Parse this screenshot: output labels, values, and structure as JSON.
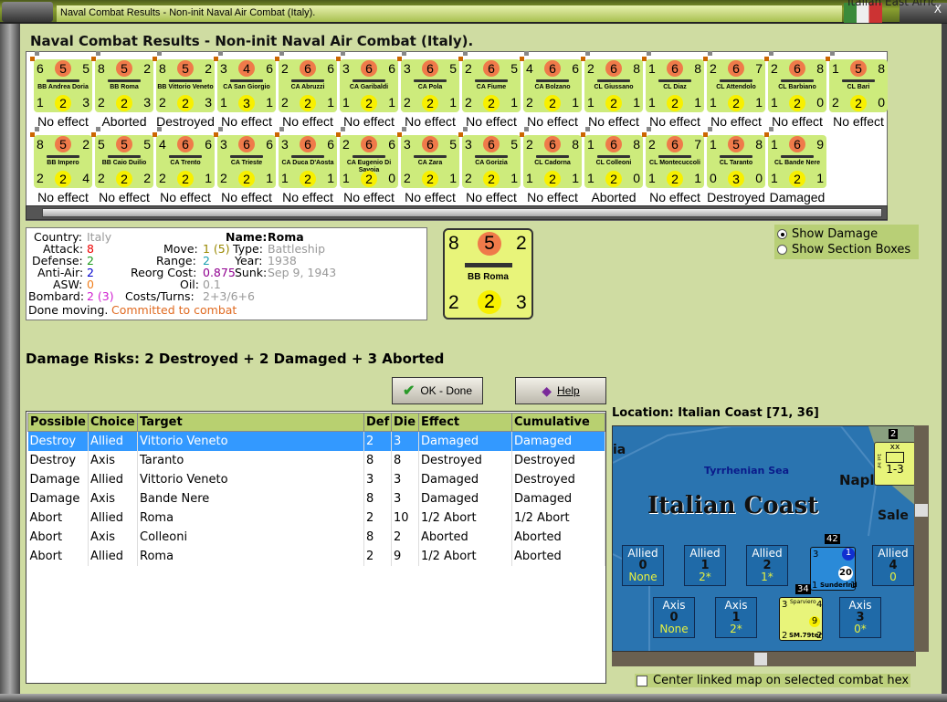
{
  "window": {
    "title": "Naval Combat Results - Non-init Naval Air Combat (Italy).",
    "corner_text": "Italian East Afric",
    "close": "X"
  },
  "heading": "Naval Combat Results - Non-init Naval Air Combat (Italy).",
  "units": [
    {
      "name": "BB Andrea Doria",
      "tl": "6",
      "tc": "5",
      "tr": "5",
      "bl": "1",
      "bc": "2",
      "br": "3",
      "result": "No effect"
    },
    {
      "name": "BB Roma",
      "tl": "8",
      "tc": "5",
      "tr": "2",
      "bl": "2",
      "bc": "2",
      "br": "3",
      "result": "Aborted"
    },
    {
      "name": "BB Vittorio Veneto",
      "tl": "8",
      "tc": "5",
      "tr": "2",
      "bl": "2",
      "bc": "2",
      "br": "3",
      "result": "Destroyed"
    },
    {
      "name": "CA San Giorgio",
      "tl": "3",
      "tc": "4",
      "tr": "6",
      "bl": "1",
      "bc": "3",
      "br": "1",
      "result": "No effect"
    },
    {
      "name": "CA Abruzzi",
      "tl": "2",
      "tc": "6",
      "tr": "6",
      "bl": "2",
      "bc": "2",
      "br": "1",
      "result": "No effect"
    },
    {
      "name": "CA Garibaldi",
      "tl": "3",
      "tc": "6",
      "tr": "6",
      "bl": "1",
      "bc": "2",
      "br": "1",
      "result": "No effect"
    },
    {
      "name": "CA Pola",
      "tl": "3",
      "tc": "6",
      "tr": "5",
      "bl": "2",
      "bc": "2",
      "br": "1",
      "result": "No effect"
    },
    {
      "name": "CA Fiume",
      "tl": "2",
      "tc": "6",
      "tr": "5",
      "bl": "2",
      "bc": "2",
      "br": "1",
      "result": "No effect"
    },
    {
      "name": "CA Bolzano",
      "tl": "4",
      "tc": "6",
      "tr": "6",
      "bl": "2",
      "bc": "2",
      "br": "1",
      "result": "No effect"
    },
    {
      "name": "CL Giussano",
      "tl": "2",
      "tc": "6",
      "tr": "8",
      "bl": "1",
      "bc": "2",
      "br": "1",
      "result": "No effect"
    },
    {
      "name": "CL Diaz",
      "tl": "1",
      "tc": "6",
      "tr": "8",
      "bl": "1",
      "bc": "2",
      "br": "1",
      "result": "No effect"
    },
    {
      "name": "CL Attendolo",
      "tl": "2",
      "tc": "6",
      "tr": "7",
      "bl": "1",
      "bc": "2",
      "br": "1",
      "result": "No effect"
    },
    {
      "name": "CL Barbiano",
      "tl": "2",
      "tc": "6",
      "tr": "8",
      "bl": "1",
      "bc": "2",
      "br": "0",
      "result": "No effect"
    },
    {
      "name": "CL Bari",
      "tl": "1",
      "tc": "5",
      "tr": "8",
      "bl": "2",
      "bc": "2",
      "br": "0",
      "result": "No effect"
    },
    {
      "name": "BB Impero",
      "tl": "8",
      "tc": "5",
      "tr": "2",
      "bl": "2",
      "bc": "2",
      "br": "4",
      "result": "No effect"
    },
    {
      "name": "BB Caio Duilio",
      "tl": "5",
      "tc": "5",
      "tr": "5",
      "bl": "2",
      "bc": "2",
      "br": "2",
      "result": "No effect"
    },
    {
      "name": "CA Trento",
      "tl": "4",
      "tc": "6",
      "tr": "6",
      "bl": "2",
      "bc": "2",
      "br": "1",
      "result": "No effect"
    },
    {
      "name": "CA Trieste",
      "tl": "3",
      "tc": "6",
      "tr": "6",
      "bl": "2",
      "bc": "2",
      "br": "1",
      "result": "No effect"
    },
    {
      "name": "CA Duca D'Aosta",
      "tl": "3",
      "tc": "6",
      "tr": "6",
      "bl": "1",
      "bc": "2",
      "br": "1",
      "result": "No effect"
    },
    {
      "name": "CA Eugenio Di Savoia",
      "tl": "2",
      "tc": "6",
      "tr": "6",
      "bl": "1",
      "bc": "2",
      "br": "0",
      "result": "No effect"
    },
    {
      "name": "CA Zara",
      "tl": "3",
      "tc": "6",
      "tr": "5",
      "bl": "2",
      "bc": "2",
      "br": "1",
      "result": "No effect"
    },
    {
      "name": "CA Gorizia",
      "tl": "3",
      "tc": "6",
      "tr": "5",
      "bl": "2",
      "bc": "2",
      "br": "1",
      "result": "No effect"
    },
    {
      "name": "CL Cadorna",
      "tl": "2",
      "tc": "6",
      "tr": "8",
      "bl": "1",
      "bc": "2",
      "br": "1",
      "result": "No effect"
    },
    {
      "name": "CL Colleoni",
      "tl": "1",
      "tc": "6",
      "tr": "8",
      "bl": "1",
      "bc": "2",
      "br": "0",
      "result": "Aborted"
    },
    {
      "name": "CL Montecuccoli",
      "tl": "2",
      "tc": "6",
      "tr": "7",
      "bl": "1",
      "bc": "2",
      "br": "1",
      "result": "No effect"
    },
    {
      "name": "CL Taranto",
      "tl": "1",
      "tc": "5",
      "tr": "8",
      "bl": "0",
      "bc": "3",
      "br": "0",
      "result": "Destroyed"
    },
    {
      "name": "CL Bande Nere",
      "tl": "1",
      "tc": "6",
      "tr": "9",
      "bl": "1",
      "bc": "2",
      "br": "1",
      "result": "Damaged"
    }
  ],
  "info": {
    "country_label": "Country:",
    "country": "Italy",
    "attack_label": "Attack:",
    "attack": "8",
    "defense_label": "Defense:",
    "defense": "2",
    "antiair_label": "Anti-Air:",
    "antiair": "2",
    "asw_label": "ASW:",
    "asw": "0",
    "bombard_label": "Bombard:",
    "bombard": "2 (3)",
    "move_label": "Move:",
    "move": "1 (5)",
    "range_label": "Range:",
    "range": "2",
    "reorg_label": "Reorg Cost:",
    "reorg": "0.875",
    "oil_label": "Oil:",
    "oil": "0.1",
    "costs_label": "Costs/Turns:",
    "costs": "2+3/6+6",
    "name_label": "Name:",
    "name": "Roma",
    "type_label": "Type:",
    "type": "Battleship",
    "year_label": "Year:",
    "year": "1938",
    "sunk_label": "Sunk:",
    "sunk": "Sep 9, 1943",
    "status": "Done moving.",
    "status2": "Committed to combat"
  },
  "selected_counter": {
    "name": "BB Roma",
    "tl": "8",
    "tc": "5",
    "tr": "2",
    "bl": "2",
    "bc": "2",
    "br": "3"
  },
  "options": {
    "show_damage": "Show Damage",
    "show_sections": "Show Section Boxes"
  },
  "damage_risks": "Damage Risks:  2 Destroyed + 2 Damaged + 3 Aborted",
  "buttons": {
    "ok": "OK - Done",
    "help": "Help"
  },
  "table": {
    "headers": [
      "Possible",
      "Choice",
      "Target",
      "Def",
      "Die",
      "Effect",
      "Cumulative"
    ],
    "rows": [
      [
        "Destroy",
        "Allied",
        "Vittorio Veneto",
        "2",
        "3",
        "Damaged",
        "Damaged"
      ],
      [
        "Destroy",
        "Axis",
        "Taranto",
        "8",
        "8",
        "Destroyed",
        "Destroyed"
      ],
      [
        "Damage",
        "Allied",
        "Vittorio Veneto",
        "3",
        "3",
        "Damaged",
        "Destroyed"
      ],
      [
        "Damage",
        "Axis",
        "Bande Nere",
        "8",
        "3",
        "Damaged",
        "Damaged"
      ],
      [
        "Abort",
        "Allied",
        "Roma",
        "2",
        "10",
        "1/2 Abort",
        "1/2 Abort"
      ],
      [
        "Abort",
        "Axis",
        "Colleoni",
        "8",
        "2",
        "Aborted",
        "Aborted"
      ],
      [
        "Abort",
        "Allied",
        "Roma",
        "2",
        "9",
        "1/2 Abort",
        "Aborted"
      ]
    ]
  },
  "map": {
    "location": "Location:  Italian Coast [71, 36]",
    "sea": "Tyrrhenian Sea",
    "region": "Italian Coast",
    "naples": "Napl",
    "salerno": "Sale",
    "edge": "ia",
    "allied_boxes": [
      {
        "side": "Allied",
        "num": "0",
        "val": "None"
      },
      {
        "side": "Allied",
        "num": "1",
        "val": "2*"
      },
      {
        "side": "Allied",
        "num": "2",
        "val": "1*"
      },
      {
        "side": "Allied",
        "num": "4",
        "val": "0"
      }
    ],
    "axis_boxes": [
      {
        "side": "Axis",
        "num": "0",
        "val": "None"
      },
      {
        "side": "Axis",
        "num": "1",
        "val": "2*"
      },
      {
        "side": "Axis",
        "num": "3",
        "val": "0*"
      }
    ],
    "allied_air": {
      "name": "Sunderlnd",
      "stack": "42",
      "tl": "3",
      "badge": "1",
      "val": "20",
      "bl": "1",
      "br": "1"
    },
    "axis_air": {
      "name": "SM.79ter",
      "sub": "Sparviero",
      "stack": "34",
      "tl": "3",
      "tr": "4",
      "val": "9",
      "bl": "2",
      "br": "2"
    },
    "land_unit": {
      "size": "xx",
      "name": "1st Inf",
      "strength": "1-3",
      "stack": "2"
    },
    "checkbox": "Center linked map on selected combat hex"
  }
}
